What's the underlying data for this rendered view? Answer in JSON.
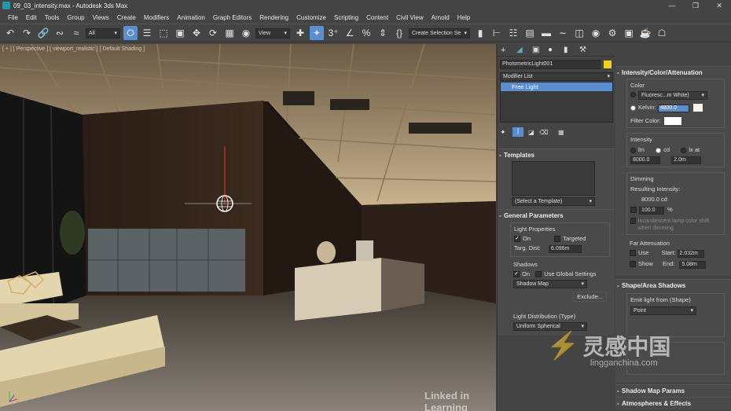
{
  "window": {
    "title": "09_03_intensity.max - Autodesk 3ds Max",
    "controls": [
      "—",
      "❐",
      "✕"
    ]
  },
  "menu": [
    "File",
    "Edit",
    "Tools",
    "Group",
    "Views",
    "Create",
    "Modifiers",
    "Animation",
    "Graph Editors",
    "Rendering",
    "Customize",
    "Scripting",
    "Content",
    "Civil View",
    "Arnold",
    "Help"
  ],
  "toolbar": {
    "selection_filter": "All",
    "ref_coord": "View",
    "named_selection": "Create Selection Se"
  },
  "viewport": {
    "label": "[ + ] [ Perspective ] [ viewport_realistic ] [ Default Shading ]"
  },
  "command_panel": {
    "object_name": "PhotometricLight001",
    "object_color": "#f2d21a",
    "modifier_list": "Modifier List",
    "stack_item": "Free Light",
    "templates": {
      "title": "Templates",
      "select": "(Select a Template)"
    },
    "general": {
      "title": "General Parameters",
      "light_properties": "Light Properties",
      "on": "On",
      "targeted": "Targeted",
      "targ_dist_label": "Targ. Dist:",
      "targ_dist": "6.096m",
      "shadows": "Shadows",
      "shadows_on": "On",
      "use_global": "Use Global Settings",
      "shadow_type": "Shadow Map",
      "exclude": "Exclude...",
      "distribution_label": "Light Distribution (Type)",
      "distribution": "Uniform Spherical"
    }
  },
  "right_panel": {
    "intensity": {
      "title": "Intensity/Color/Attenuation",
      "color_label": "Color",
      "preset": "Fluoresc...m White)",
      "kelvin_label": "Kelvin:",
      "kelvin": "4800.0",
      "filter_label": "Filter Color:",
      "intensity_label": "Intensity",
      "units": [
        "lm",
        "cd",
        "lx at"
      ],
      "intensity_value": "8000.0",
      "lx_dist": "2.0m",
      "dimming_label": "Dimming",
      "resulting_label": "Resulting Intensity:",
      "resulting_value": "8000.0 cd",
      "dim_percent": "100.0",
      "percent_sign": "%",
      "incandescent": "Incandescent lamp color shift when dimming",
      "far_label": "Far Attenuation",
      "use": "Use",
      "show": "Show",
      "start_label": "Start:",
      "start": "2.032m",
      "end_label": "End:",
      "end": "5.08m"
    },
    "shape": {
      "title": "Shape/Area Shadows",
      "emit_label": "Emit light from (Shape)",
      "emit_value": "Point"
    },
    "shadow_map_params": "Shadow Map Params",
    "atmospheres": "Atmospheres & Effects"
  },
  "watermarks": {
    "linkedin": "Linked in Learning",
    "brand_cn": "灵感中国",
    "brand_url": "lingganchina.com"
  },
  "colors": {
    "accent": "#5a8ed0",
    "panel": "#444444",
    "swatch_kelvin": "#fff4e6",
    "swatch_filter": "#ffffff"
  }
}
